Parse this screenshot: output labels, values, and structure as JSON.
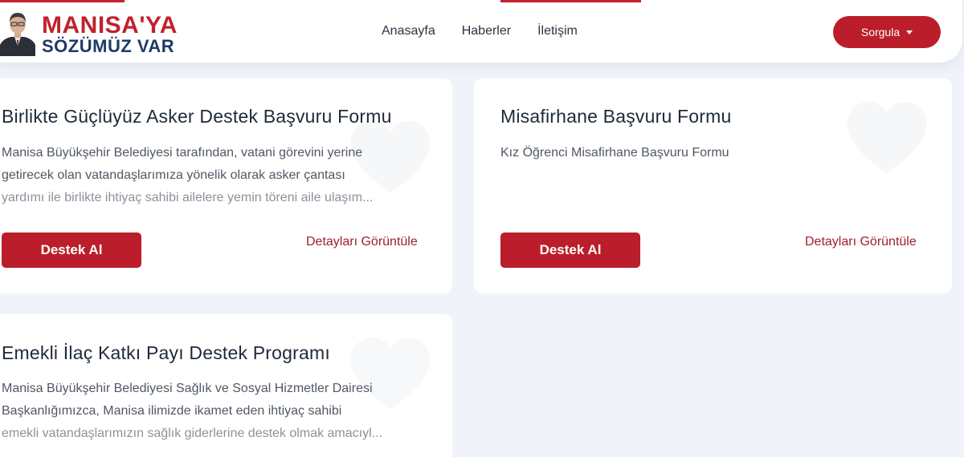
{
  "header": {
    "logo": {
      "line1": "MANISA'YA",
      "line2": "SÖZÜMÜZ VAR"
    },
    "nav": [
      "Anasayfa",
      "Haberler",
      "İletişim"
    ],
    "query_button": "Sorgula"
  },
  "cards": [
    {
      "title": "Birlikte Güçlüyüz Asker Destek Başvuru Formu",
      "description_lines": [
        "Manisa Büyükşehir Belediyesi tarafından, vatani görevini yerine",
        "getirecek olan vatandaşlarımıza yönelik olarak asker çantası",
        "yardımı ile birlikte ihtiyaç sahibi ailelere yemin töreni aile ulaşım..."
      ],
      "primary_button": "Destek Al",
      "details_link": "Detayları Görüntüle"
    },
    {
      "title": "Misafirhane Başvuru Formu",
      "description_lines": [
        "Kız Öğrenci Misafirhane Başvuru Formu"
      ],
      "primary_button": "Destek Al",
      "details_link": "Detayları Görüntüle"
    },
    {
      "title": "Emekli İlaç Katkı Payı Destek Programı",
      "description_lines": [
        "Manisa Büyükşehir Belediyesi Sağlık ve Sosyal Hizmetler Dairesi",
        "Başkanlığımızca, Manisa ilimizde ikamet eden ihtiyaç sahibi",
        "emekli vatandaşlarımızın sağlık giderlerine destek olmak amacıyl..."
      ]
    }
  ],
  "icons": {
    "portrait": "person-portrait",
    "dropdown": "caret-down-icon",
    "card_decoration": "heart-icon"
  },
  "colors": {
    "brand_red": "#bb1e2a",
    "brand_navy": "#1e3a67",
    "page_bg": "#f0f4fa"
  }
}
